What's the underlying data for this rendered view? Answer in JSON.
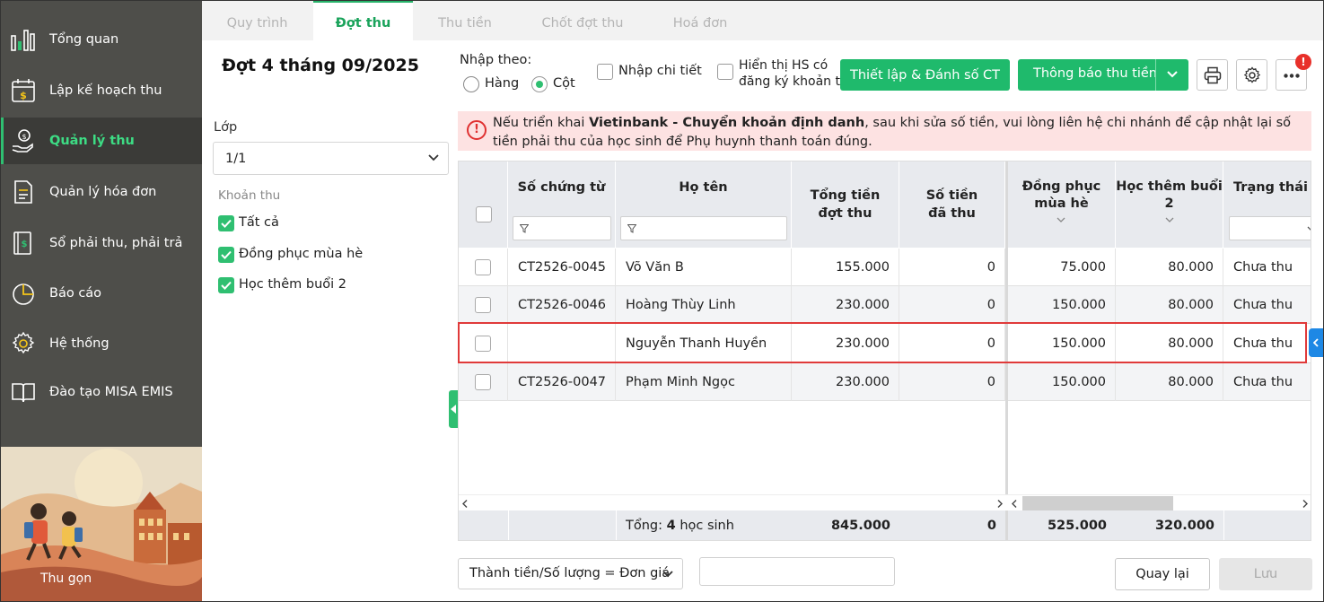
{
  "sidebar": {
    "items": [
      {
        "label": "Tổng quan",
        "icon": "bar-chart-icon"
      },
      {
        "label": "Lập kế hoạch thu",
        "icon": "calendar-money-icon"
      },
      {
        "label": "Quản lý thu",
        "icon": "hand-coin-icon",
        "active": true
      },
      {
        "label": "Quản lý hóa đơn",
        "icon": "document-icon"
      },
      {
        "label": "Sổ phải thu, phải trả",
        "icon": "ledger-icon"
      },
      {
        "label": "Báo cáo",
        "icon": "pie-chart-icon"
      },
      {
        "label": "Hệ thống",
        "icon": "gear-icon"
      },
      {
        "label": "Đào tạo MISA EMIS",
        "icon": "book-icon"
      }
    ],
    "collapse_label": "Thu gọn"
  },
  "tabs": [
    "Quy trình",
    "Đợt thu",
    "Thu tiền",
    "Chốt đợt thu",
    "Hoá đơn"
  ],
  "active_tab": "Đợt thu",
  "left_panel": {
    "title": "Đợt 4 tháng 09/2025",
    "class_label": "Lớp",
    "class_value": "1/1",
    "fees_label": "Khoản thu",
    "fees": [
      "Tất cả",
      "Đồng phục mùa hè",
      "Học thêm buổi 2"
    ]
  },
  "toolbar": {
    "input_by_label": "Nhập theo:",
    "radio_row": "Hàng",
    "radio_col": "Cột",
    "detail_label": "Nhập chi tiết",
    "show_hs_line1": "Hiển thị HS có",
    "show_hs_line2": "đăng ký khoản thu",
    "setup_button": "Thiết lập & Đánh số CT",
    "notify_button": "Thông báo thu tiền",
    "badge": "!"
  },
  "warning": {
    "prefix": "Nếu triển khai ",
    "bold": "Vietinbank - Chuyển khoản định danh",
    "suffix": ", sau khi sửa số tiền, vui lòng liên hệ chi nhánh để cập nhật lại số tiền phải thu của học sinh để Phụ huynh thanh toán đúng."
  },
  "table": {
    "headers": {
      "doc_no": "Số chứng từ",
      "name": "Họ tên",
      "total_l1": "Tổng tiền",
      "total_l2": "đợt thu",
      "paid_l1": "Số tiền",
      "paid_l2": "đã thu",
      "uniform_l1": "Đồng phục",
      "uniform_l2": "mùa hè",
      "extra_l1": "Học thêm buổi",
      "extra_l2": "2",
      "status": "Trạng thái thu"
    },
    "rows": [
      {
        "doc_no": "CT2526-0045",
        "name": "Võ Văn B",
        "total": "155.000",
        "paid": "0",
        "uniform": "75.000",
        "extra": "80.000",
        "status": "Chưa thu"
      },
      {
        "doc_no": "CT2526-0046",
        "name": "Hoàng Thùy Linh",
        "total": "230.000",
        "paid": "0",
        "uniform": "150.000",
        "extra": "80.000",
        "status": "Chưa thu"
      },
      {
        "doc_no": "",
        "name": "Nguyễn Thanh Huyền",
        "total": "230.000",
        "paid": "0",
        "uniform": "150.000",
        "extra": "80.000",
        "status": "Chưa thu"
      },
      {
        "doc_no": "CT2526-0047",
        "name": "Phạm Minh Ngọc",
        "total": "230.000",
        "paid": "0",
        "uniform": "150.000",
        "extra": "80.000",
        "status": "Chưa thu"
      }
    ],
    "footer": {
      "label_prefix": "Tổng: ",
      "count": "4",
      "label_suffix": " học sinh",
      "total": "845.000",
      "paid": "0",
      "uniform": "525.000",
      "extra": "320.000"
    }
  },
  "bottom": {
    "formula": "Thành tiền/Số lượng = Đơn giá",
    "back_button": "Quay lại",
    "save_button": "Lưu"
  },
  "colors": {
    "sidebar_bg": "#4e4e4a",
    "accent_green": "#1fba6c",
    "warning_bg": "#fde2e2",
    "highlight_red": "#e03a3a"
  }
}
